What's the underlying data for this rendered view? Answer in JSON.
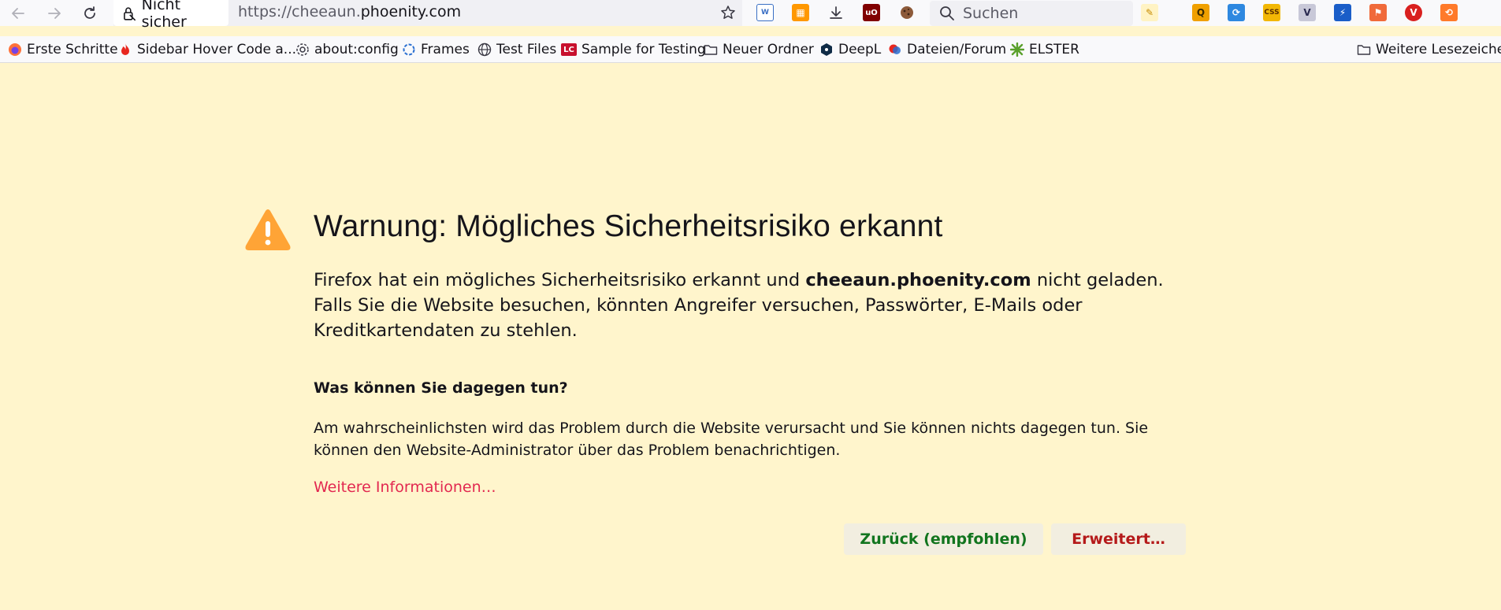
{
  "window": {
    "url_prefix": "https://cheeaun.",
    "url_host": "phoenity.com"
  },
  "toolbar": {
    "back_icon": "back-arrow-icon",
    "forward_icon": "forward-arrow-icon",
    "reload_icon": "reload-icon",
    "site_identity_label": "Nicht sicher",
    "search_placeholder": "Suchen"
  },
  "bookmarks": {
    "items": [
      {
        "label": "Erste Schritte",
        "icon": "firefox-icon"
      },
      {
        "label": "Sidebar Hover Code a...",
        "icon": "flame-icon"
      },
      {
        "label": "about:config",
        "icon": "gear-icon"
      },
      {
        "label": "Frames",
        "icon": "frames-icon"
      },
      {
        "label": "Test Files",
        "icon": "globe-icon"
      },
      {
        "label": "Sample for Testing",
        "icon": "lc-icon"
      },
      {
        "label": "Neuer Ordner",
        "icon": "folder-icon"
      },
      {
        "label": "DeepL",
        "icon": "deepl-icon"
      },
      {
        "label": "Dateien/Forum",
        "icon": "forum-icon"
      },
      {
        "label": "ELSTER",
        "icon": "elster-icon"
      }
    ],
    "other": "Weitere Lesezeichen"
  },
  "content": {
    "title": "Warnung: Mögliches Sicherheitsrisiko erkannt",
    "intro_before": "Firefox hat ein mögliches Sicherheitsrisiko erkannt und ",
    "intro_host": "cheeaun.phoenity.com",
    "intro_after": " nicht geladen. Falls Sie die Website besuchen, könnten Angreifer versuchen, Passwörter, E-Mails oder Kreditkartendaten zu stehlen.",
    "subhead": "Was können Sie dagegen tun?",
    "body": "Am wahrscheinlichsten wird das Problem durch die Website verursacht und Sie können nichts dagegen tun. Sie können den Website-Administrator über das Problem benachrichtigen.",
    "more_link": "Weitere Informationen…",
    "back_button": "Zurück (empfohlen)",
    "advanced_button": "Erweitert…"
  },
  "colors": {
    "page_background": "#fff5cc",
    "warning_icon": "#ffa436",
    "link": "#e22850",
    "back_button_text": "#12751f",
    "advanced_button_text": "#b51a1a"
  }
}
